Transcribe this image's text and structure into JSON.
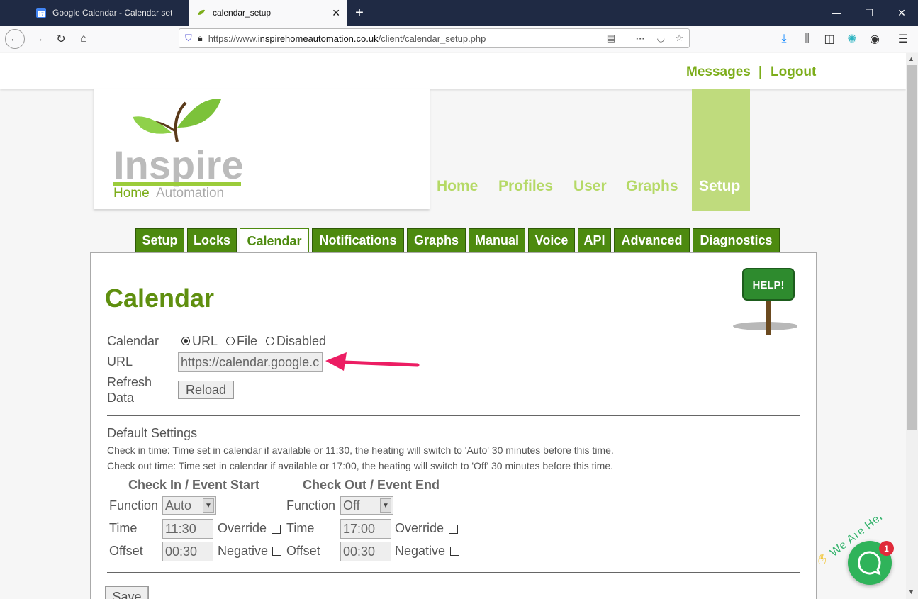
{
  "browser": {
    "tabs": [
      {
        "title": "Google Calendar - Calendar set",
        "icon": "google-calendar-icon",
        "badge": "17"
      },
      {
        "title": "calendar_setup",
        "icon": "leaf-favicon-icon"
      }
    ],
    "url_prefix": "https://www.",
    "url_domain": "inspirehomeautomation.co.uk",
    "url_path": "/client/calendar_setup.php"
  },
  "top_links": {
    "messages": "Messages",
    "separator": "|",
    "logout": "Logout"
  },
  "logo": {
    "line1": "Inspire",
    "line2a": "Home",
    "line2b": "Automation"
  },
  "main_nav": [
    "Home",
    "Profiles",
    "User",
    "Graphs",
    "Setup"
  ],
  "sub_tabs": [
    "Setup",
    "Locks",
    "Calendar",
    "Notifications",
    "Graphs",
    "Manual",
    "Voice",
    "API",
    "Advanced",
    "Diagnostics"
  ],
  "help_sign": "HELP!",
  "page_title": "Calendar",
  "calendar_label": "Calendar",
  "source_options": [
    "URL",
    "File",
    "Disabled"
  ],
  "selected_source": "URL",
  "url_label": "URL",
  "url_value": "https://calendar.google.c",
  "refresh_label_1": "Refresh",
  "refresh_label_2": "Data",
  "reload_button": "Reload",
  "defaults": {
    "heading": "Default Settings",
    "checkin_note": "Check in time: Time set in calendar if available or 11:30, the heating will switch to 'Auto' 30 minutes before this time.",
    "checkout_note": "Check out time: Time set in calendar if available or 17:00, the heating will switch to 'Off' 30 minutes before this time."
  },
  "checkin": {
    "heading": "Check In / Event Start",
    "function_label": "Function",
    "function_value": "Auto",
    "time_label": "Time",
    "time_value": "11:30",
    "override_label": "Override",
    "offset_label": "Offset",
    "offset_value": "00:30",
    "negative_label": "Negative"
  },
  "checkout": {
    "heading": "Check Out / Event End",
    "function_label": "Function",
    "function_value": "Off",
    "time_label": "Time",
    "time_value": "17:00",
    "override_label": "Override",
    "offset_label": "Offset",
    "offset_value": "00:30",
    "negative_label": "Negative"
  },
  "save_button": "Save",
  "chat": {
    "banner": "We Are Here!",
    "badge": "1"
  },
  "colors": {
    "brand_green": "#7cad1a",
    "tab_green": "#4d8a0f",
    "arrow_pink": "#ec1d63"
  }
}
